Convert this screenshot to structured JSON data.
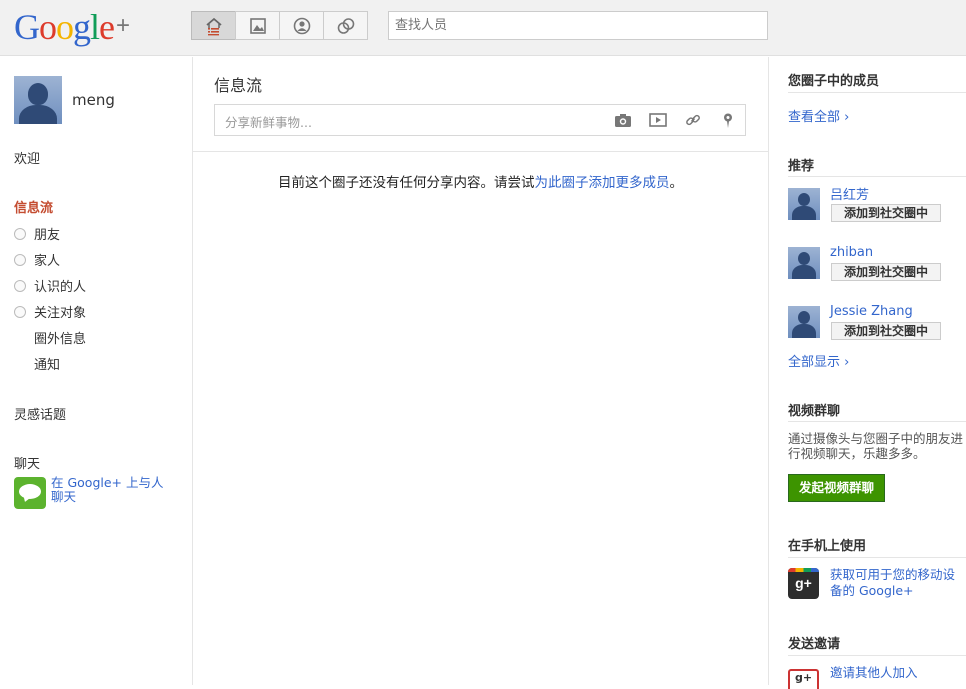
{
  "header": {
    "logo_letters": [
      "G",
      "o",
      "o",
      "g",
      "l",
      "e"
    ],
    "logo_plus": "+",
    "tabs": [
      {
        "name": "home",
        "icon": "home-stream-icon",
        "active": true
      },
      {
        "name": "photos",
        "icon": "photos-icon",
        "active": false
      },
      {
        "name": "profile",
        "icon": "profile-icon",
        "active": false
      },
      {
        "name": "circles",
        "icon": "circles-icon",
        "active": false
      }
    ],
    "search_placeholder": "查找人员"
  },
  "sidebar": {
    "username": "meng",
    "welcome": "欢迎",
    "stream_title": "信息流",
    "circles": [
      "朋友",
      "家人",
      "认识的人",
      "关注对象"
    ],
    "sub_items": [
      "圈外信息",
      "通知"
    ],
    "sparks": "灵感话题",
    "chat_title": "聊天",
    "chat_link": "在 Google+ 上与人聊天"
  },
  "main": {
    "title": "信息流",
    "share_placeholder": "分享新鲜事物...",
    "share_icons": [
      "camera-icon",
      "video-icon",
      "link-icon",
      "location-pin-icon"
    ],
    "empty_text": "目前这个圈子还没有任何分享内容。请尝试",
    "empty_link": "为此圈子添加更多成员",
    "empty_end": "。"
  },
  "right": {
    "members_title": "您圈子中的成员",
    "view_all": "查看全部 ›",
    "suggest_title": "推荐",
    "suggestions": [
      {
        "name": "吕红芳",
        "button": "添加到社交圈中"
      },
      {
        "name": "zhiban",
        "button": "添加到社交圈中"
      },
      {
        "name": "Jessie Zhang",
        "button": "添加到社交圈中"
      }
    ],
    "show_all": "全部显示 ›",
    "hangout_title": "视频群聊",
    "hangout_text": "通过摄像头与您圈子中的朋友进行视频聊天，乐趣多多。",
    "hangout_button": "发起视频群聊",
    "mobile_title": "在手机上使用",
    "mobile_link": "获取可用于您的移动设备的 Google+",
    "mobile_icon_text": "g+",
    "invite_title": "发送邀请",
    "invite_link": "邀请其他人加入",
    "invite_icon_text": "g+"
  }
}
